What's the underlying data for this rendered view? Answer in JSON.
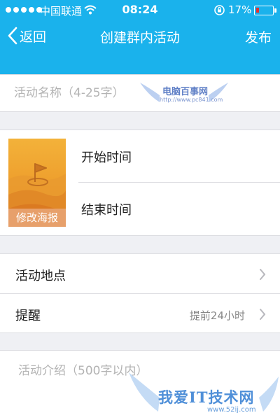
{
  "status_bar": {
    "carrier": "中国联通",
    "time": "08:24",
    "battery_percent": "17%",
    "battery_level": 0.17,
    "signal_bars": 5,
    "icons": [
      "wifi-icon",
      "rotation-lock-icon",
      "battery-icon"
    ]
  },
  "nav": {
    "back_label": "返回",
    "title": "创建群内活动",
    "publish_label": "发布",
    "background": "#1ab2ec"
  },
  "form": {
    "name_placeholder": "活动名称（4-25字）",
    "poster_label": "修改海报",
    "start_time_label": "开始时间",
    "end_time_label": "结束时间",
    "location_label": "活动地点",
    "reminder_label": "提醒",
    "reminder_value": "提前24小时",
    "description_placeholder": "活动介绍（500字以内）"
  },
  "watermarks": {
    "top_text": "电脑百事网",
    "top_url": "http://www.pc841.com",
    "bottom_text": "我爱IT技术网",
    "bottom_url": "www.52ij.com"
  }
}
